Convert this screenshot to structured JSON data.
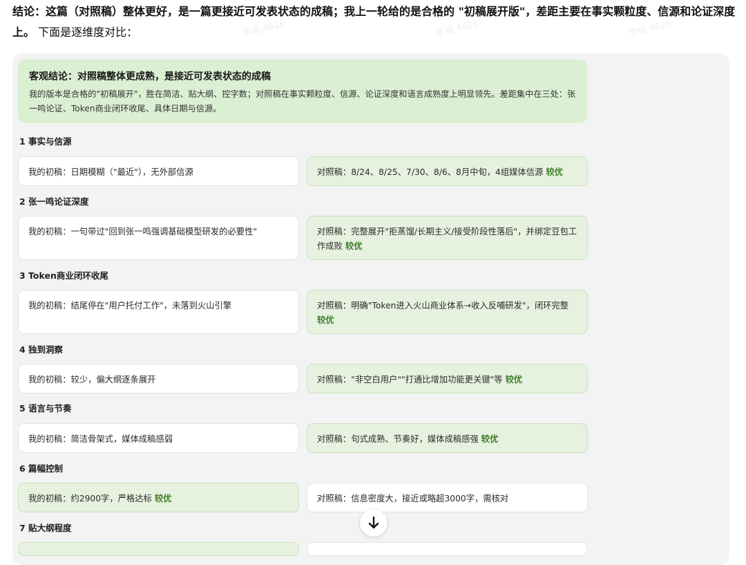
{
  "intro": {
    "bold": "结论：这篇（对照稿）整体更好，是一篇更接近可发表状态的成稿；我上一轮给的是合格的 \"初稿展开版\"，差距主要在事实颗粒度、信源和论证深度上。",
    "rest": " 下面是逐维度对比："
  },
  "summary": {
    "title": "客观结论：对照稿整体更成熟，是接近可发表状态的成稿",
    "body": "我的版本是合格的\"初稿展开\"，胜在简洁、贴大纲、控字数；对照稿在事实颗粒度、信源、论证深度和语言成熟度上明显领先。差距集中在三处：张一鸣论证、Token商业闭环收尾、具体日期与信源。"
  },
  "sections": [
    {
      "title": "1 事实与信源",
      "left": "我的初稿：日期模糊（\"最近\"），无外部信源",
      "right": "对照稿：8/24、8/25、7/30、8/6、8月中旬，4组媒体信源",
      "winner": "right",
      "badge": "较优"
    },
    {
      "title": "2 张一鸣论证深度",
      "left": "我的初稿：一句带过\"回到张一鸣强调基础模型研发的必要性\"",
      "right": "对照稿：完整展开\"拒蒸馏/长期主义/接受阶段性落后\"，并绑定豆包工作成败",
      "winner": "right",
      "badge": "较优"
    },
    {
      "title": "3 Token商业闭环收尾",
      "left": "我的初稿：结尾停在\"用户托付工作\"，未落到火山引擎",
      "right": "对照稿：明确\"Token进入火山商业体系→收入反哺研发\"，闭环完整",
      "winner": "right",
      "badge": "较优"
    },
    {
      "title": "4 独到洞察",
      "left": "我的初稿：较少，偏大纲逐条展开",
      "right": "对照稿：\"非空白用户\"\"打通比增加功能更关键\"等",
      "winner": "right",
      "badge": "较优"
    },
    {
      "title": "5 语言与节奏",
      "left": "我的初稿：简洁骨架式，媒体成稿感弱",
      "right": "对照稿：句式成熟、节奏好，媒体成稿感强",
      "winner": "right",
      "badge": "较优"
    },
    {
      "title": "6 篇幅控制",
      "left": "我的初稿：约2900字，严格达标",
      "right": "对照稿：信息密度大，接近或略超3000字，需核对",
      "winner": "left",
      "badge": "较优"
    },
    {
      "title": "7 贴大纲程度"
    }
  ],
  "scroll_icon": "arrow-down-icon",
  "watermark": "李威 4626",
  "colors": {
    "win_bg": "#e6f2df",
    "badge": "#3f7f2a",
    "summary_bg": "#dbefd3"
  }
}
